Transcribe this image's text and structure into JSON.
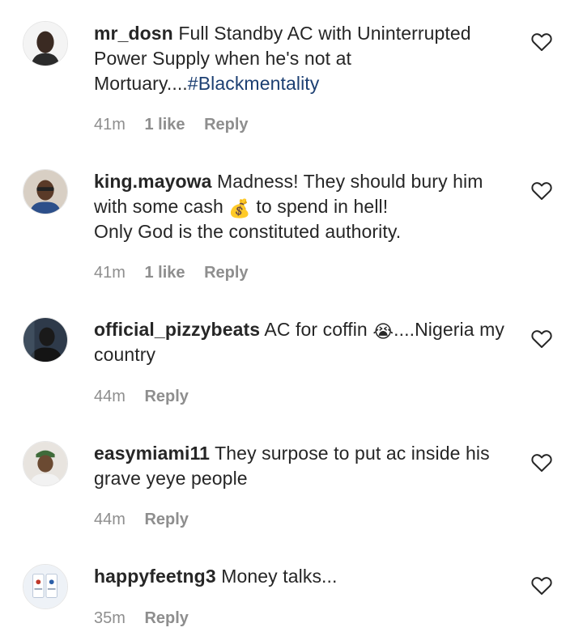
{
  "comments": [
    {
      "username": "mr_dosn",
      "text_before": "Full Standby AC with Uninterrupted Power Supply when he's not at Mortuary....",
      "hashtag": "#Blackmentality",
      "time": "41m",
      "likes": "1 like",
      "reply": "Reply"
    },
    {
      "username": "king.mayowa",
      "text_before": "Madness! They should bury him with some cash",
      "emoji": "💰",
      "text_after": "to spend in hell!",
      "text_line2": "Only God is the constituted authority.",
      "time": "41m",
      "likes": "1 like",
      "reply": "Reply"
    },
    {
      "username": "official_pizzybeats",
      "text_before": "AC for coffin",
      "emoji": "😭",
      "text_after": "....Nigeria my country",
      "time": "44m",
      "reply": "Reply"
    },
    {
      "username": "easymiami11",
      "text_before": "They surpose to put ac inside his grave yeye people",
      "time": "44m",
      "reply": "Reply"
    },
    {
      "username": "happyfeetng3",
      "text_before": "Money talks...",
      "time": "35m",
      "reply": "Reply"
    }
  ],
  "colors": {
    "text": "#262626",
    "meta": "#8e8e8e",
    "hashtag": "#1c3f72",
    "heart_stroke": "#262626"
  },
  "icons": {
    "like": "heart-outline-icon"
  }
}
